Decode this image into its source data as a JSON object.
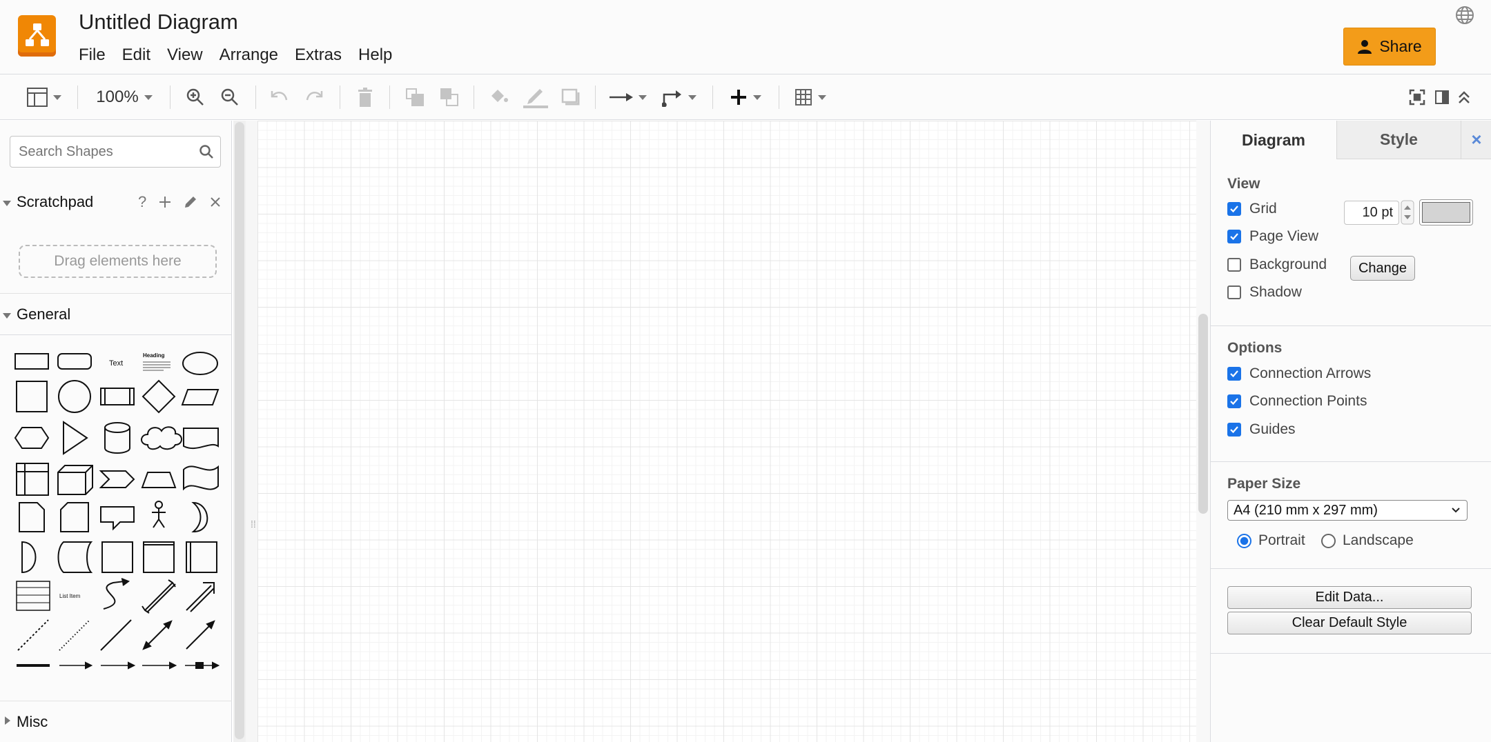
{
  "app": {
    "title": "Untitled Diagram",
    "accent": "#f08705"
  },
  "menu": [
    "File",
    "Edit",
    "View",
    "Arrange",
    "Extras",
    "Help"
  ],
  "header": {
    "share_label": "Share"
  },
  "toolbar": {
    "zoom": "100%"
  },
  "sidebar": {
    "search_placeholder": "Search Shapes",
    "scratchpad_title": "Scratchpad",
    "scratchpad_drop": "Drag elements here",
    "scratchpad_help": "?",
    "general_title": "General",
    "misc_title": "Misc",
    "shape_labels": {
      "text": "Text",
      "heading": "Heading",
      "list_item": "List Item"
    }
  },
  "panel": {
    "tabs": [
      "Diagram",
      "Style"
    ],
    "view_title": "View",
    "grid_label": "Grid",
    "grid_size": "10 pt",
    "page_view_label": "Page View",
    "background_label": "Background",
    "change_label": "Change",
    "shadow_label": "Shadow",
    "options_title": "Options",
    "connection_arrows_label": "Connection Arrows",
    "connection_points_label": "Connection Points",
    "guides_label": "Guides",
    "paper_title": "Paper Size",
    "paper_value": "A4 (210 mm x 297 mm)",
    "portrait_label": "Portrait",
    "landscape_label": "Landscape",
    "edit_data_label": "Edit Data...",
    "clear_style_label": "Clear Default Style",
    "checks": {
      "grid": true,
      "page_view": true,
      "background": false,
      "shadow": false,
      "connection_arrows": true,
      "connection_points": true,
      "guides": true
    },
    "orientation": "Portrait"
  }
}
